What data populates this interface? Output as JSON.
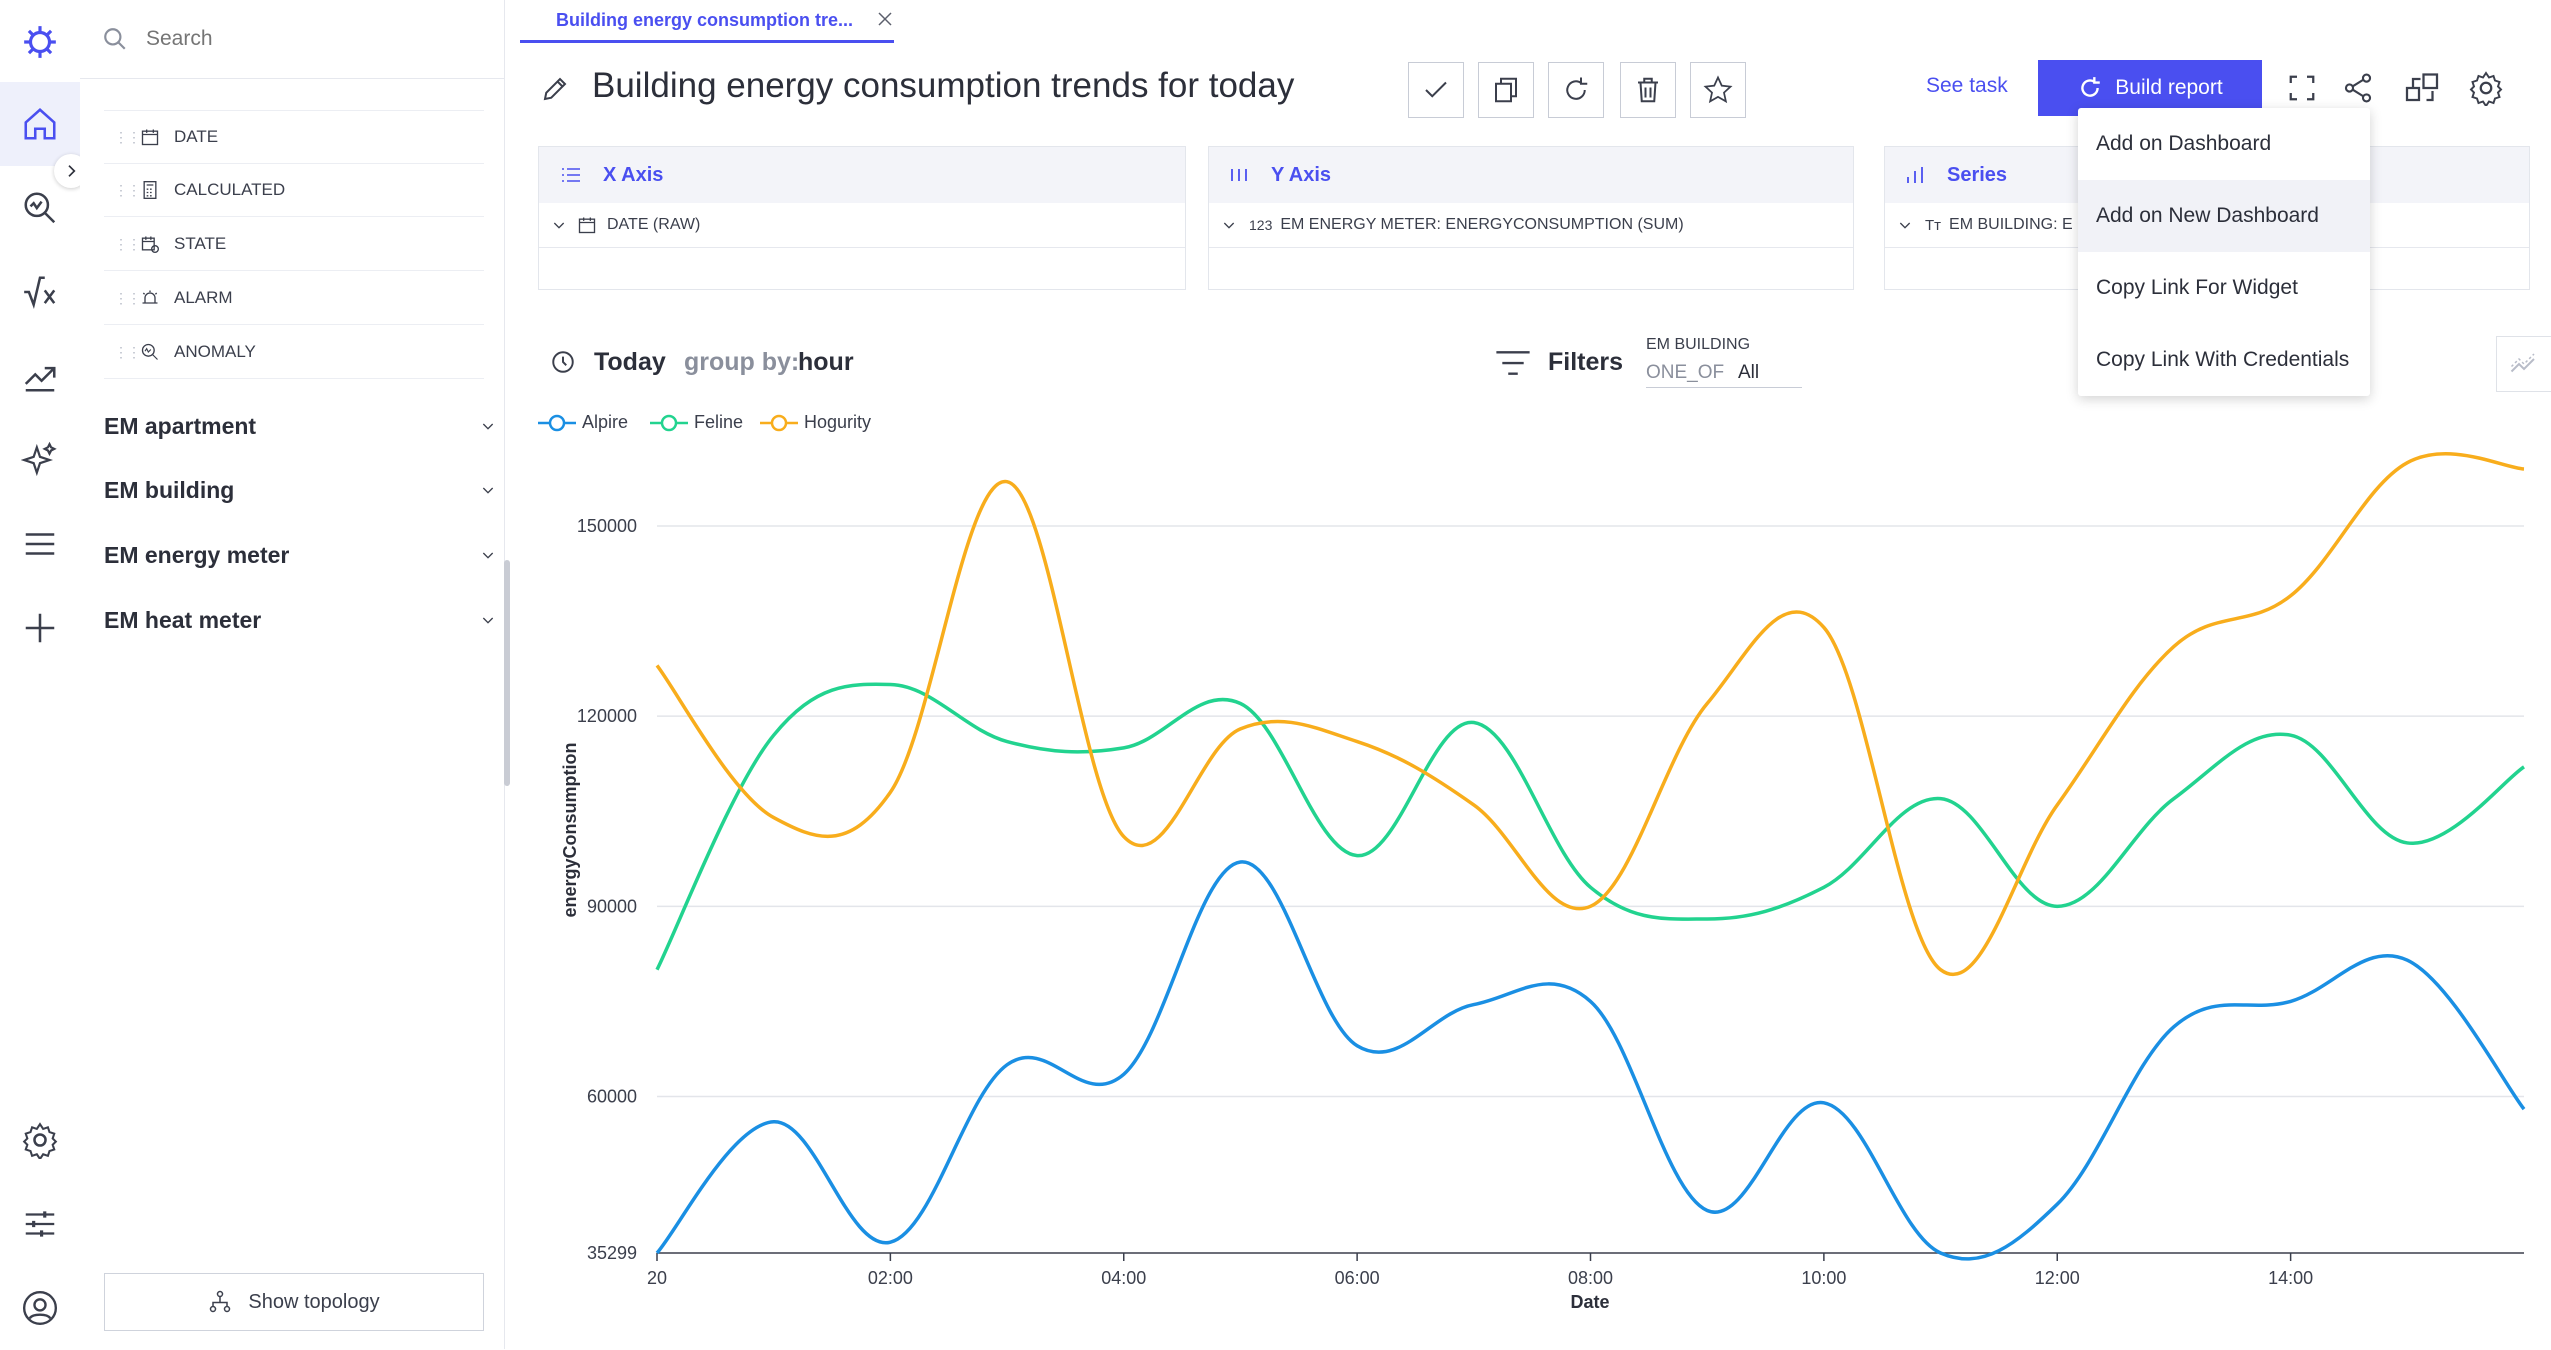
{
  "sidebar": {
    "search_placeholder": "Search",
    "fields": [
      {
        "label": "DATE",
        "icon": "calendar-icon"
      },
      {
        "label": "CALCULATED",
        "icon": "calculator-icon"
      },
      {
        "label": "STATE",
        "icon": "state-calendar-icon"
      },
      {
        "label": "ALARM",
        "icon": "alarm-icon"
      },
      {
        "label": "ANOMALY",
        "icon": "anomaly-icon"
      }
    ],
    "groups": [
      "EM apartment",
      "EM building",
      "EM energy meter",
      "EM heat meter"
    ],
    "show_topology": "Show topology"
  },
  "tab": {
    "label": "Building energy consumption tre..."
  },
  "header": {
    "title": "Building energy consumption trends for today",
    "see_task": "See task",
    "build_report": "Build report"
  },
  "axes": {
    "x_axis": {
      "title": "X Axis",
      "field": "DATE (RAW)"
    },
    "y_axis": {
      "title": "Y Axis",
      "prefix": "123",
      "field": "EM ENERGY METER: ENERGYCONSUMPTION (SUM)"
    },
    "series": {
      "title": "Series",
      "prefix": "Tт",
      "field": "EM BUILDING: E"
    }
  },
  "menu": {
    "items": [
      "Add on Dashboard",
      "Add on New Dashboard",
      "Copy Link For Widget",
      "Copy Link With Credentials"
    ]
  },
  "filters_bar": {
    "period": "Today",
    "group_by_label": "group by:",
    "group_by_value": "hour",
    "filters_label": "Filters",
    "filter_name": "EM BUILDING",
    "filter_op": "ONE_OF",
    "filter_value": "All"
  },
  "colors": {
    "accent": "#4a4ff0",
    "alpire": "#1a8fe3",
    "feline": "#22d38f",
    "hogurity": "#f8ad1c"
  },
  "chart_data": {
    "type": "line",
    "xlabel": "Date",
    "ylabel": "energyConsumption",
    "x_ticks": [
      "20",
      "02:00",
      "04:00",
      "06:00",
      "08:00",
      "10:00",
      "12:00",
      "14:00"
    ],
    "y_ticks": [
      "35299",
      "60000",
      "90000",
      "120000",
      "150000"
    ],
    "ylim": [
      35299,
      162000
    ],
    "x": [
      0,
      1,
      2,
      3,
      4,
      5,
      6,
      7,
      8,
      9,
      10,
      11,
      12,
      13,
      14,
      15,
      16
    ],
    "series": [
      {
        "name": "Alpire",
        "values": [
          35299,
          56000,
          37000,
          65000,
          63500,
          97000,
          68000,
          74500,
          75000,
          42000,
          59000,
          35299,
          43000,
          71000,
          75000,
          81500,
          58000
        ]
      },
      {
        "name": "Feline",
        "values": [
          80000,
          117000,
          125000,
          116000,
          115000,
          122000,
          98000,
          119000,
          93000,
          88000,
          93000,
          107000,
          90000,
          107000,
          117000,
          100000,
          112000
        ]
      },
      {
        "name": "Hogurity",
        "values": [
          128000,
          104000,
          108000,
          157000,
          101000,
          118000,
          116000,
          106000,
          90000,
          122000,
          134000,
          80000,
          106000,
          131000,
          139000,
          160000,
          159000
        ]
      }
    ],
    "grid": true,
    "legend": "top-left"
  }
}
